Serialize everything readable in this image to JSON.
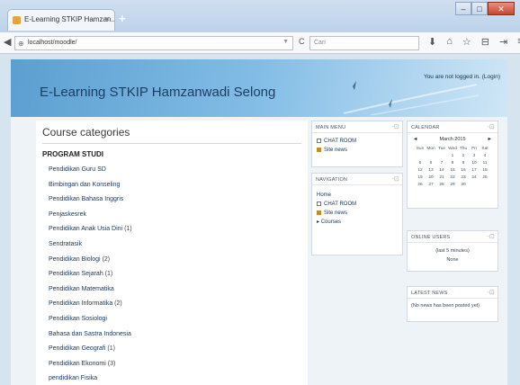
{
  "browser": {
    "tab_title": "E-Learning STKIP Hamzan...",
    "tab_close": "×",
    "new_tab": "+",
    "url": "localhost/moodle/",
    "search_placeholder": "Cari",
    "window": {
      "minimize": "–",
      "maximize": "□",
      "close": "✕"
    },
    "icons": {
      "back": "◀",
      "globe": "⊕",
      "dropdown": "▼",
      "reload": "C",
      "download": "⬇",
      "home": "⌂",
      "bookmark": "☆",
      "clipboard": "⊟",
      "pocket": "⇥",
      "menu": "≡"
    }
  },
  "header": {
    "site_title": "E-Learning STKIP Hamzanwadi Selong",
    "login_text": "You are not logged in. (Login)"
  },
  "main": {
    "heading": "Course categories",
    "category_title": "PROGRAM STUDI",
    "categories": [
      {
        "name": "Pendidikan Guru SD",
        "count": ""
      },
      {
        "name": "Bimbingan dan Konseling",
        "count": ""
      },
      {
        "name": "Pendidikan Bahasa Inggris",
        "count": ""
      },
      {
        "name": "Penjaskesrek",
        "count": ""
      },
      {
        "name": "Pendidikan Anak Usia Dini",
        "count": "(1)"
      },
      {
        "name": "Sendratasik",
        "count": ""
      },
      {
        "name": "Pendidikan Biologi",
        "count": "(2)"
      },
      {
        "name": "Pendidikan Sejarah",
        "count": "(1)"
      },
      {
        "name": "Pendidikan Matematika",
        "count": ""
      },
      {
        "name": "Pendidikan Informatika",
        "count": "(2)"
      },
      {
        "name": "Pendidikan Sosiologi",
        "count": ""
      },
      {
        "name": "Bahasa dan Sastra Indonesia",
        "count": ""
      },
      {
        "name": "Pendidikan Geografi",
        "count": "(1)"
      },
      {
        "name": "Pendidikan Ekonomi",
        "count": "(3)"
      },
      {
        "name": "pendidikan Fisika",
        "count": ""
      }
    ]
  },
  "main_menu": {
    "title": "MAIN MENU",
    "items": [
      {
        "label": "CHAT ROOM",
        "icon": "chat-icon"
      },
      {
        "label": "Site news",
        "icon": "news-icon"
      }
    ]
  },
  "navigation": {
    "title": "NAVIGATION",
    "home": "Home",
    "items": [
      {
        "label": "CHAT ROOM",
        "icon": "chat-icon"
      },
      {
        "label": "Site news",
        "icon": "news-icon"
      }
    ],
    "courses": "Courses",
    "courses_arrow": "▸"
  },
  "calendar": {
    "title": "CALENDAR",
    "month": "March 2015",
    "prev": "◄",
    "next": "►",
    "days": [
      "Sun",
      "Mon",
      "Tue",
      "Wed",
      "Thu",
      "Fri",
      "Sat"
    ],
    "weeks": [
      [
        "",
        "",
        "",
        "1",
        "2",
        "3",
        "4"
      ],
      [
        "5",
        "6",
        "7",
        "8",
        "9",
        "10",
        "11"
      ],
      [
        "12",
        "13",
        "14",
        "15",
        "16",
        "17",
        "18"
      ],
      [
        "19",
        "20",
        "21",
        "22",
        "23",
        "24",
        "25"
      ],
      [
        "26",
        "27",
        "28",
        "29",
        "30",
        "",
        ""
      ]
    ]
  },
  "online_users": {
    "title": "ONLINE USERS",
    "line1": "(last 5 minutes)",
    "line2": "None"
  },
  "latest_news": {
    "title": "LATEST NEWS",
    "text": "(No news has been posted yet)"
  },
  "move_glyph": "-⊡"
}
